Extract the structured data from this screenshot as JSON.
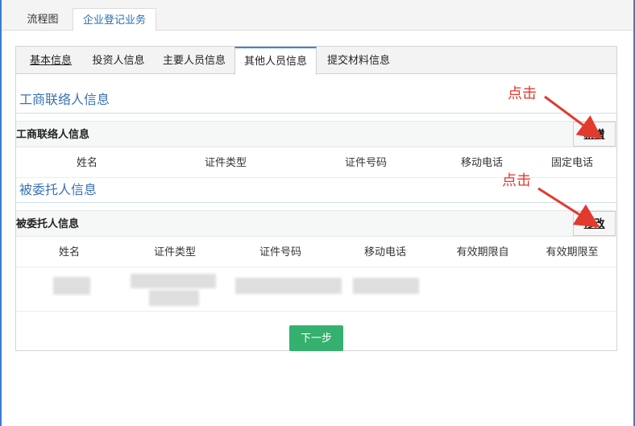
{
  "top_tabs": [
    {
      "label": "流程图"
    },
    {
      "label": "企业登记业务"
    }
  ],
  "inner_tabs": [
    {
      "label": "基本信息"
    },
    {
      "label": "投资人信息"
    },
    {
      "label": "主要人员信息"
    },
    {
      "label": "其他人员信息"
    },
    {
      "label": "提交材料信息"
    }
  ],
  "section1": {
    "title": "工商联络人信息",
    "sub_label": "工商联络人信息",
    "button": "新增",
    "columns": [
      "姓名",
      "证件类型",
      "证件号码",
      "移动电话",
      "固定电话"
    ]
  },
  "section2": {
    "title": "被委托人信息",
    "sub_label": "被委托人信息",
    "button": "修改",
    "columns": [
      "姓名",
      "证件类型",
      "证件号码",
      "移动电话",
      "有效期限自",
      "有效期限至"
    ]
  },
  "next_button": "下一步",
  "annotations": [
    "点击",
    "点击"
  ],
  "colors": {
    "accent": "#3a86d6",
    "annotation": "#e23a2d",
    "next": "#35b06f"
  }
}
